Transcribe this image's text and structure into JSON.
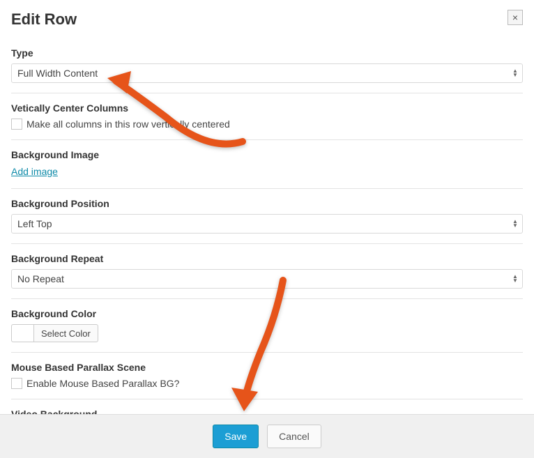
{
  "header": {
    "title": "Edit Row",
    "close": "×"
  },
  "fields": {
    "type": {
      "label": "Type",
      "value": "Full Width Content"
    },
    "vcc": {
      "label": "Vetically Center Columns",
      "checkbox_label": "Make all columns in this row vertically centered"
    },
    "bg_image": {
      "label": "Background Image",
      "link": "Add image"
    },
    "bg_position": {
      "label": "Background Position",
      "value": "Left Top"
    },
    "bg_repeat": {
      "label": "Background Repeat",
      "value": "No Repeat"
    },
    "bg_color": {
      "label": "Background Color",
      "button": "Select Color"
    },
    "parallax": {
      "label": "Mouse Based Parallax Scene",
      "checkbox_label": "Enable Mouse Based Parallax BG?"
    },
    "video_bg": {
      "label": "Video Background"
    }
  },
  "footer": {
    "save": "Save",
    "cancel": "Cancel"
  },
  "annotation_color": "#e6541a"
}
